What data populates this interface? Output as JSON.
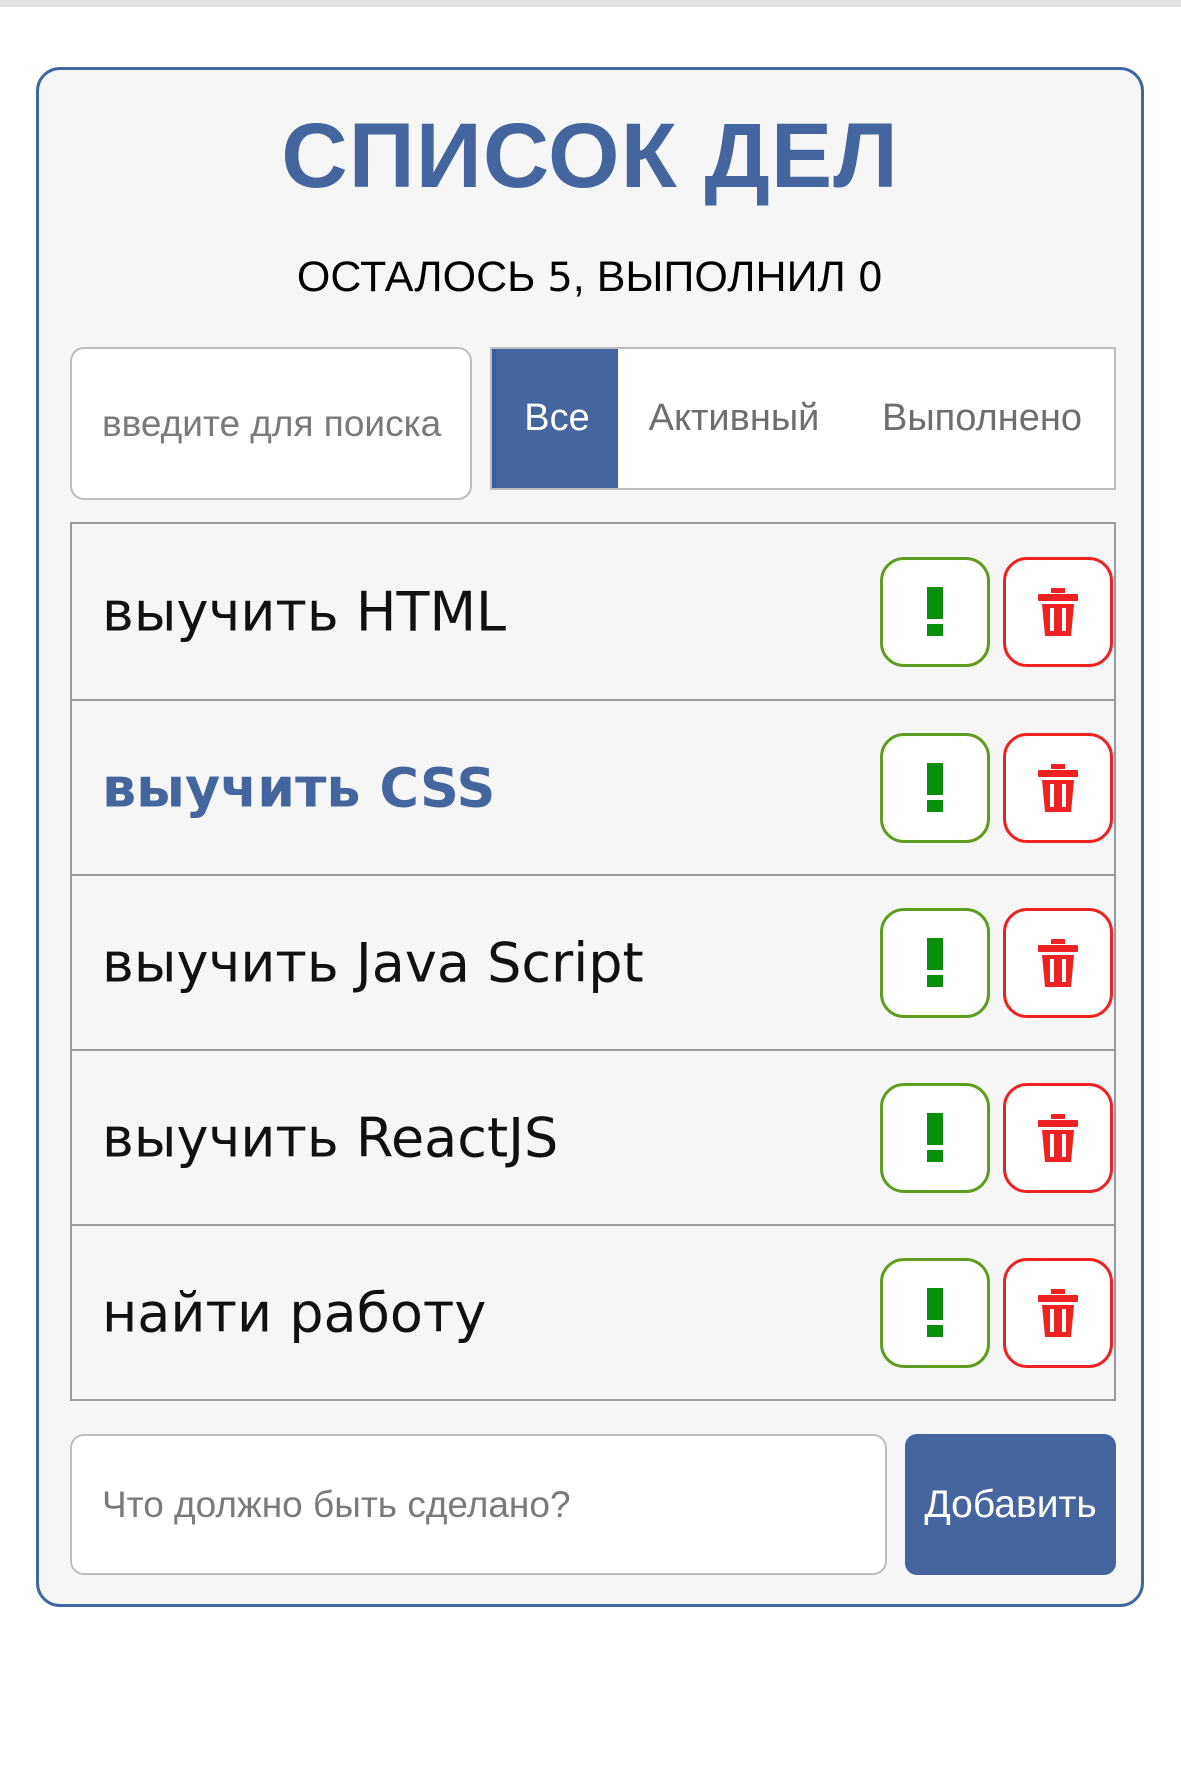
{
  "header": {
    "title": "СПИСОК ДЕЛ",
    "status_remaining_label": "ОСТАЛОСЬ",
    "status_remaining_count": "5",
    "status_separator": ",",
    "status_done_label": "ВЫПОЛНИЛ",
    "status_done_count": "0"
  },
  "search": {
    "placeholder": "введите для поиска",
    "value": ""
  },
  "filters": {
    "all": "Все",
    "active": "Активный",
    "done": "Выполнено",
    "selected": "Все"
  },
  "todos": [
    {
      "label": "выучить HTML",
      "important": false,
      "done": false
    },
    {
      "label": "выучить CSS",
      "important": true,
      "done": false
    },
    {
      "label": "выучить Java Script",
      "important": false,
      "done": false
    },
    {
      "label": "выучить ReactJS",
      "important": false,
      "done": false
    },
    {
      "label": "найти работу",
      "important": false,
      "done": false
    }
  ],
  "icons": {
    "important": "exclamation-icon",
    "delete": "trash-icon"
  },
  "add_form": {
    "placeholder": "Что должно быть сделано?",
    "value": "",
    "button_label": "Добавить"
  },
  "colors": {
    "accent": "#44659d",
    "important_border": "#5f9c1f",
    "important_glyph": "#0a8f0a",
    "delete": "#ee2222"
  }
}
